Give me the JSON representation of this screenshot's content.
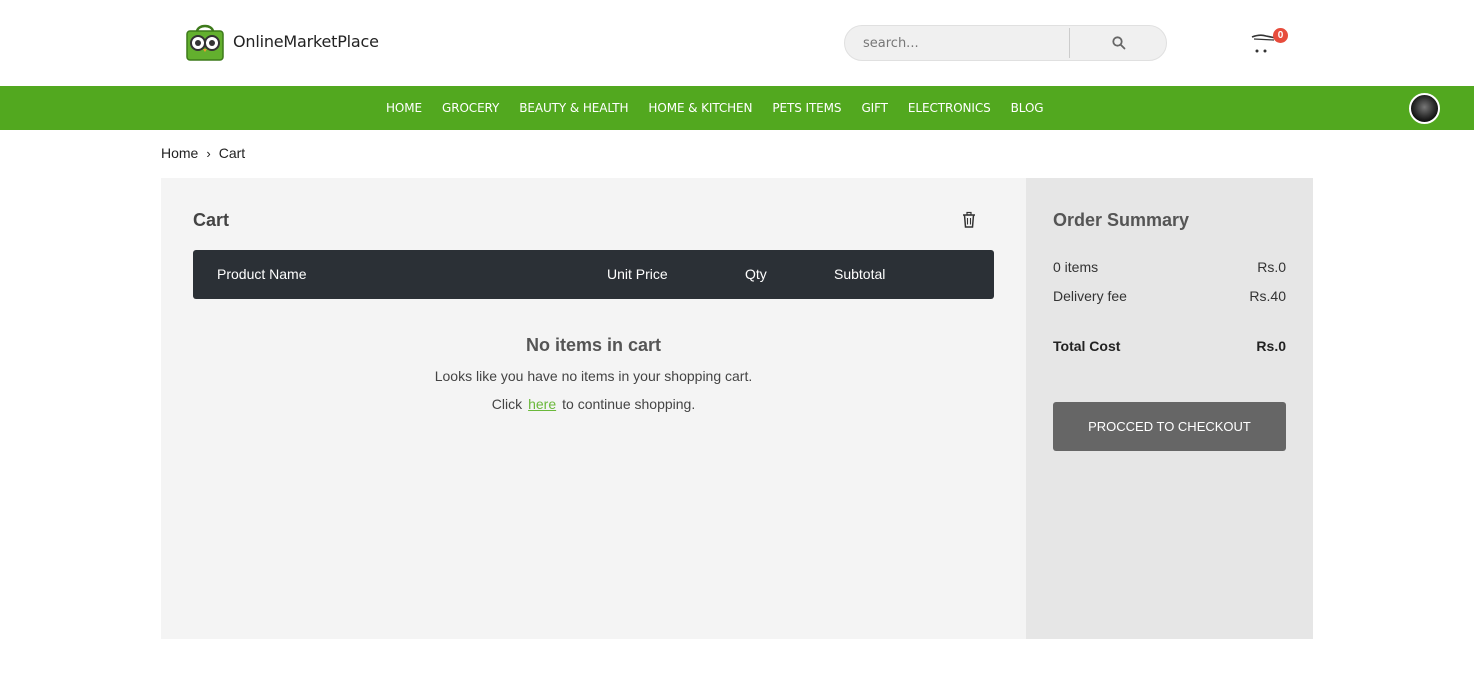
{
  "brand": {
    "name": "OnlineMarketPlace"
  },
  "search": {
    "placeholder": "search..."
  },
  "cart_icon": {
    "badge_count": "0"
  },
  "nav": {
    "items": [
      "HOME",
      "GROCERY",
      "BEAUTY & HEALTH",
      "HOME & KITCHEN",
      "PETS ITEMS",
      "GIFT",
      "ELECTRONICS",
      "BLOG"
    ],
    "color": "#52a81f"
  },
  "breadcrumb": {
    "home": "Home",
    "separator": "›",
    "current": "Cart"
  },
  "cart": {
    "title": "Cart",
    "columns": {
      "product": "Product Name",
      "unit_price": "Unit Price",
      "qty": "Qty",
      "subtotal": "Subtotal"
    },
    "empty": {
      "title": "No items in cart",
      "line1": "Looks like you have no items in your shopping cart.",
      "click": "Click",
      "link": "here",
      "after": "to continue shopping."
    }
  },
  "summary": {
    "title": "Order Summary",
    "items_label": "0 items",
    "items_value": "Rs.0",
    "delivery_label": "Delivery fee",
    "delivery_value": "Rs.40",
    "total_label": "Total Cost",
    "total_value": "Rs.0",
    "checkout_label": "PROCCED TO CHECKOUT"
  },
  "colors": {
    "accent": "#52a81f",
    "table_header": "#2b3036",
    "badge": "#e74c3c",
    "link": "#6ab83a"
  }
}
